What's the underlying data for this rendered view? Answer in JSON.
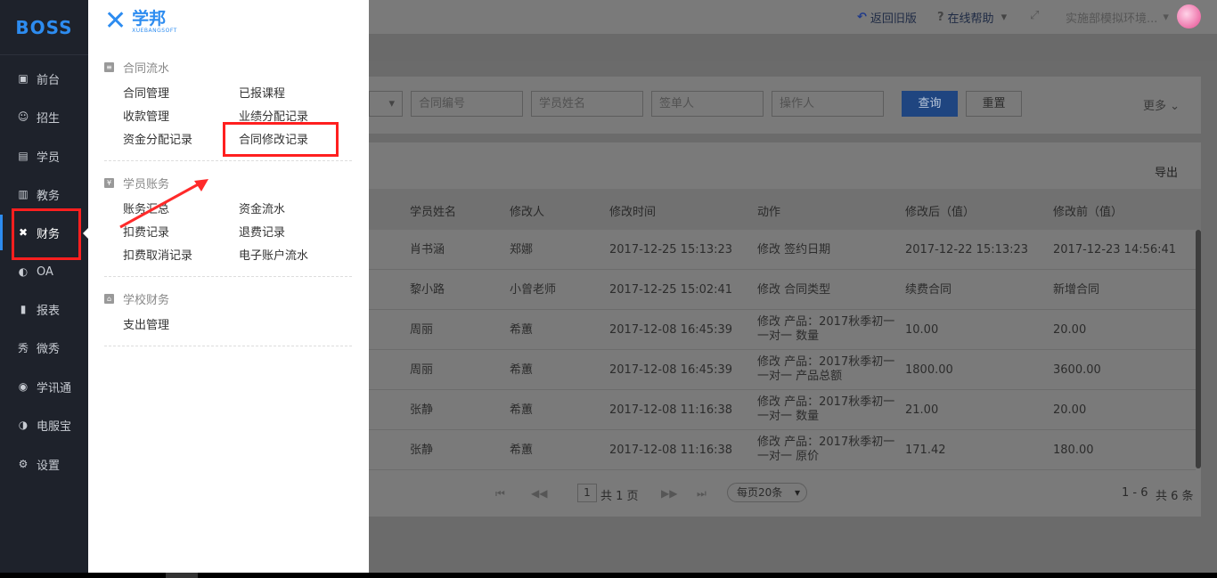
{
  "nav": {
    "logo": "BOSS",
    "items": [
      {
        "label": "前台",
        "icon": "calendar-icon",
        "glyph": "▣"
      },
      {
        "label": "招生",
        "icon": "users-icon",
        "glyph": "☺"
      },
      {
        "label": "学员",
        "icon": "student-icon",
        "glyph": "▤"
      },
      {
        "label": "教务",
        "icon": "book-icon",
        "glyph": "▥"
      },
      {
        "label": "财务",
        "icon": "finance-icon",
        "glyph": "✖"
      },
      {
        "label": "OA",
        "icon": "oa-icon",
        "glyph": "◐"
      },
      {
        "label": "报表",
        "icon": "chart-icon",
        "glyph": "▮"
      },
      {
        "label": "微秀",
        "icon": "show-icon",
        "glyph": "秀"
      },
      {
        "label": "学讯通",
        "icon": "location-icon",
        "glyph": "◉"
      },
      {
        "label": "电服宝",
        "icon": "phone-icon",
        "glyph": "◑"
      },
      {
        "label": "设置",
        "icon": "gear-icon",
        "glyph": "⚙"
      }
    ]
  },
  "panel": {
    "brand_cn": "学邦",
    "brand_en": "XUEBANGSOFT",
    "sections": [
      {
        "title": "合同流水",
        "icon": "document-icon",
        "glyph": "≡",
        "links": [
          "合同管理",
          "已报课程",
          "收款管理",
          "业绩分配记录",
          "资金分配记录",
          "合同修改记录"
        ]
      },
      {
        "title": "学员账务",
        "icon": "yen-icon",
        "glyph": "¥",
        "links": [
          "账务汇总",
          "资金流水",
          "扣费记录",
          "退费记录",
          "扣费取消记录",
          "电子账户流水"
        ]
      },
      {
        "title": "学校财务",
        "icon": "home-icon",
        "glyph": "⌂",
        "links": [
          "支出管理"
        ]
      }
    ]
  },
  "topbar": {
    "back": "返回旧版",
    "help": "在线帮助",
    "org": "实施部模拟环境..."
  },
  "filter": {
    "contract_no": "合同编号",
    "student_name": "学员姓名",
    "signer": "签单人",
    "operator": "操作人",
    "query": "查询",
    "reset": "重置",
    "more": "更多"
  },
  "table": {
    "export": "导出",
    "headers": [
      "学员姓名",
      "修改人",
      "修改时间",
      "动作",
      "修改后（值）",
      "修改前（值）"
    ],
    "rows": [
      {
        "student": "肖书涵",
        "editor": "郑娜",
        "time": "2017-12-25 15:13:23",
        "action1": "修改 签约日期",
        "action2": "",
        "after": "2017-12-22 15:13:23",
        "before": "2017-12-23 14:56:41"
      },
      {
        "student": "黎小路",
        "editor": "小曾老师",
        "time": "2017-12-25 15:02:41",
        "action1": "修改 合同类型",
        "action2": "",
        "after": "续费合同",
        "before": "新增合同"
      },
      {
        "student": "周丽",
        "editor": "希蕙",
        "time": "2017-12-08 16:45:39",
        "action1": "修改 产品：2017秋季初一",
        "action2": "一对一 数量",
        "after": "10.00",
        "before": "20.00"
      },
      {
        "student": "周丽",
        "editor": "希蕙",
        "time": "2017-12-08 16:45:39",
        "action1": "修改 产品：2017秋季初一",
        "action2": "一对一 产品总额",
        "after": "1800.00",
        "before": "3600.00"
      },
      {
        "student": "张静",
        "editor": "希蕙",
        "time": "2017-12-08 11:16:38",
        "action1": "修改 产品：2017秋季初一",
        "action2": "一对一 数量",
        "after": "21.00",
        "before": "20.00"
      },
      {
        "student": "张静",
        "editor": "希蕙",
        "time": "2017-12-08 11:16:38",
        "action1": "修改 产品：2017秋季初一",
        "action2": "一对一 原价",
        "after": "171.42",
        "before": "180.00"
      }
    ]
  },
  "pager": {
    "page": "1",
    "total_pages": "共 1 页",
    "page_size": "每页20条",
    "range": "1 - 6",
    "total": "共 6 条"
  },
  "colors": {
    "accent": "#2d8cf0",
    "highlight": "#ff1f1f",
    "nav_bg": "#1e222b"
  }
}
